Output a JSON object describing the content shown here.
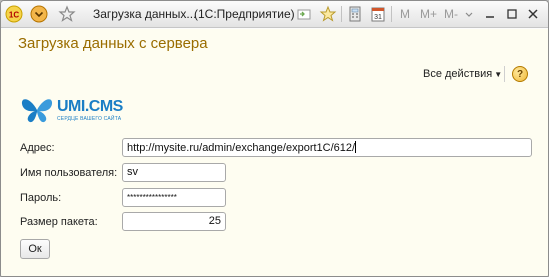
{
  "window": {
    "title": "Загрузка данных...",
    "app_title": "(1С:Предприятие)",
    "mem_buttons": [
      "M",
      "M+",
      "M-"
    ]
  },
  "form": {
    "title": "Загрузка данных с сервера",
    "all_actions_label": "Все действия",
    "help_label": "?",
    "logo": {
      "text": "UMI.CMS",
      "subtitle": "сердце вашего сайта"
    },
    "fields": {
      "address": {
        "label": "Адрес:",
        "value": "http://mysite.ru/admin/exchange/export1C/612/"
      },
      "username": {
        "label": "Имя пользователя:",
        "value": "sv"
      },
      "password": {
        "label": "Пароль:",
        "value": "****************"
      },
      "packet_size": {
        "label": "Размер пакета:",
        "value": "25"
      }
    },
    "ok_label": "Ок"
  },
  "colors": {
    "title": "#9a6d00",
    "background": "#fefdf1",
    "logo": "#1b7ec5"
  }
}
